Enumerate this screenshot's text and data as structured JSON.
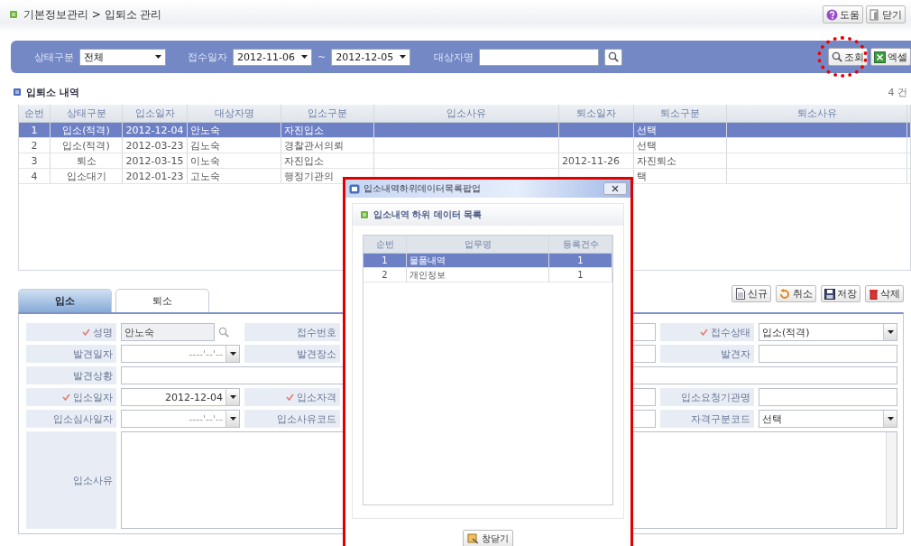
{
  "breadcrumb": "기본정보관리 > 입퇴소 관리",
  "header_buttons": [
    {
      "label": "도움"
    },
    {
      "label": "닫기"
    }
  ],
  "filters": {
    "status_label": "상태구분",
    "status_value": "전체",
    "date_label": "접수일자",
    "date_from": "2012-11-06",
    "date_sep": "~",
    "date_to": "2012-12-05",
    "name_label": "대상자명"
  },
  "filter_buttons": [
    {
      "label": "조회",
      "highlighted": true
    },
    {
      "label": "엑셀",
      "highlighted": false
    }
  ],
  "list": {
    "title": "입퇴소 내역",
    "count": "4 건",
    "columns": [
      "순번",
      "상태구분",
      "입소일자",
      "대상자명",
      "입소구분",
      "입소사유",
      "퇴소일자",
      "퇴소구분",
      "퇴소사유"
    ],
    "rows": [
      {
        "selected": true,
        "cells": [
          "1",
          "입소(적격)",
          "2012-12-04",
          "안노숙",
          "자진입소",
          null,
          null,
          "선택",
          null
        ]
      },
      {
        "selected": false,
        "cells": [
          "2",
          "입소(적격)",
          "2012-03-23",
          "김노숙",
          "경찰관서의뢰",
          null,
          null,
          "선택",
          null
        ]
      },
      {
        "selected": false,
        "cells": [
          "3",
          "퇴소",
          "2012-03-15",
          "이노숙",
          "자진입소",
          null,
          "2012-11-26",
          "자진퇴소",
          null
        ]
      },
      {
        "selected": false,
        "cells": [
          "4",
          "입소대기",
          "2012-01-23",
          "고노숙",
          "행정기관의",
          null,
          null,
          "택",
          null
        ]
      }
    ]
  },
  "tabs": [
    {
      "label": "입소",
      "selected": true
    },
    {
      "label": "퇴소",
      "selected": false
    }
  ],
  "actions": [
    {
      "label": "신규"
    },
    {
      "label": "취소"
    },
    {
      "label": "저장"
    },
    {
      "label": "삭제"
    }
  ],
  "form": [
    [
      {
        "label": "성명",
        "required": true,
        "kind": "lookup",
        "value": "안노숙",
        "disabled": true
      },
      {
        "label": "접수번호",
        "required": false,
        "kind": "covered"
      },
      {
        "label": "접수상태",
        "required": true,
        "kind": "select",
        "value": "입소(적격)"
      }
    ],
    [
      {
        "label": "발견일자",
        "required": false,
        "kind": "date",
        "placeholder": "----'--'--"
      },
      {
        "label": "발견장소",
        "required": false,
        "kind": "covered"
      },
      {
        "label": "발견자",
        "required": false,
        "kind": "text"
      }
    ],
    [
      {
        "label": "발견상황",
        "required": false,
        "kind": "text"
      }
    ],
    [
      {
        "label": "입소일자",
        "required": true,
        "kind": "date",
        "value": "2012-12-04"
      },
      {
        "label": "입소자격",
        "required": true,
        "kind": "covered"
      },
      {
        "label": "입소요청기관명",
        "required": false,
        "kind": "text"
      }
    ],
    [
      {
        "label": "입소심사일자",
        "required": false,
        "kind": "date",
        "placeholder": "----'--'--"
      },
      {
        "label": "입소사유코드",
        "required": false,
        "kind": "covered"
      },
      {
        "label": "자격구분코드",
        "required": false,
        "kind": "select",
        "value": "선택"
      }
    ],
    [
      {
        "label": "입소사유",
        "required": false,
        "kind": "area"
      }
    ]
  ],
  "popup": {
    "title": "입소내역하위데이터목록팝업",
    "section": "입소내역 하위 데이터 목록",
    "columns": [
      "순번",
      "업무명",
      "등록건수"
    ],
    "rows": [
      {
        "selected": true,
        "cells": [
          "1",
          "물품내역",
          "1"
        ]
      },
      {
        "selected": false,
        "cells": [
          "2",
          "개인정보",
          "1"
        ]
      }
    ],
    "close_button": "창닫기"
  }
}
